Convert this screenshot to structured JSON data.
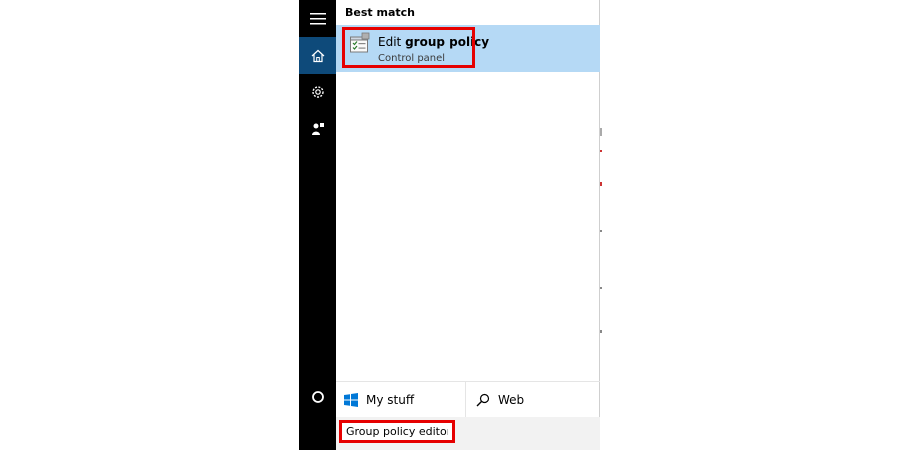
{
  "search": {
    "section_header": "Best match",
    "query": "Group policy editor"
  },
  "best_match": {
    "title_prefix": "Edit ",
    "title_bold": "group policy",
    "subtitle": "Control panel",
    "icon": "group-policy-icon"
  },
  "scopes": {
    "my_stuff": {
      "label": "My stuff",
      "icon": "windows-logo-icon"
    },
    "web": {
      "label": "Web",
      "icon": "search-icon"
    }
  },
  "rail": {
    "items": [
      {
        "name": "hamburger-menu-icon"
      },
      {
        "name": "home-icon",
        "active": true
      },
      {
        "name": "gear-icon"
      },
      {
        "name": "feedback-icon"
      },
      {
        "name": "cortana-circle-icon"
      }
    ]
  },
  "colors": {
    "rail_bg": "#000000",
    "active_bg": "#0e4a7a",
    "selected_result_bg": "#b5d9f5",
    "highlight_red": "#e60000"
  }
}
